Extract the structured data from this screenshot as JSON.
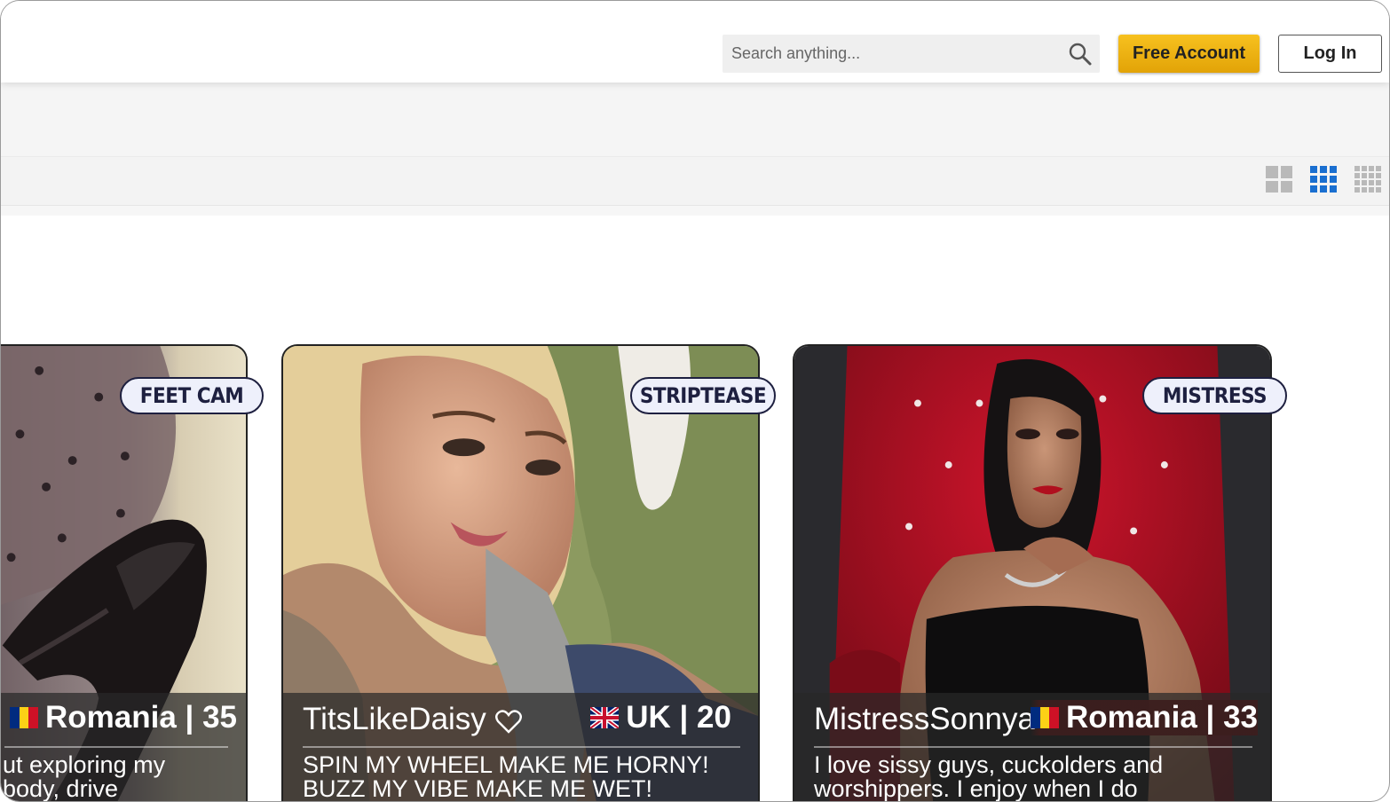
{
  "header": {
    "search": {
      "placeholder": "Search anything..."
    },
    "free_account_label": "Free Account",
    "login_label": "Log In"
  },
  "layout_toggle": {
    "options": [
      "grid-large-icon",
      "grid-medium-icon",
      "grid-small-icon"
    ],
    "selected": "grid-medium-icon",
    "active_color": "#1a6fd0"
  },
  "cards": [
    {
      "tag": "FEET CAM",
      "name": "",
      "country": "Romania",
      "age": "35",
      "country_age": "Romania | 35",
      "description_line1": "ut exploring my",
      "description_line2": "body, drive"
    },
    {
      "tag": "STRIPTEASE",
      "name": "TitsLikeDaisy",
      "country": "UK",
      "age": "20",
      "country_age": "UK | 20",
      "description_line1": "SPIN MY WHEEL MAKE ME HORNY!",
      "description_line2": "BUZZ MY VIBE MAKE ME WET!"
    },
    {
      "tag": "MISTRESS",
      "name": "MistressSonnya",
      "country": "Romania",
      "age": "33",
      "country_age": "Romania | 33",
      "description_line1": "I love sissy guys, cuckolders and",
      "description_line2": "worshippers. I enjoy when I do"
    }
  ],
  "colors": {
    "accent": "#f5b90f",
    "tag_bg": "#eef0fb",
    "tag_text": "#1e2040"
  }
}
